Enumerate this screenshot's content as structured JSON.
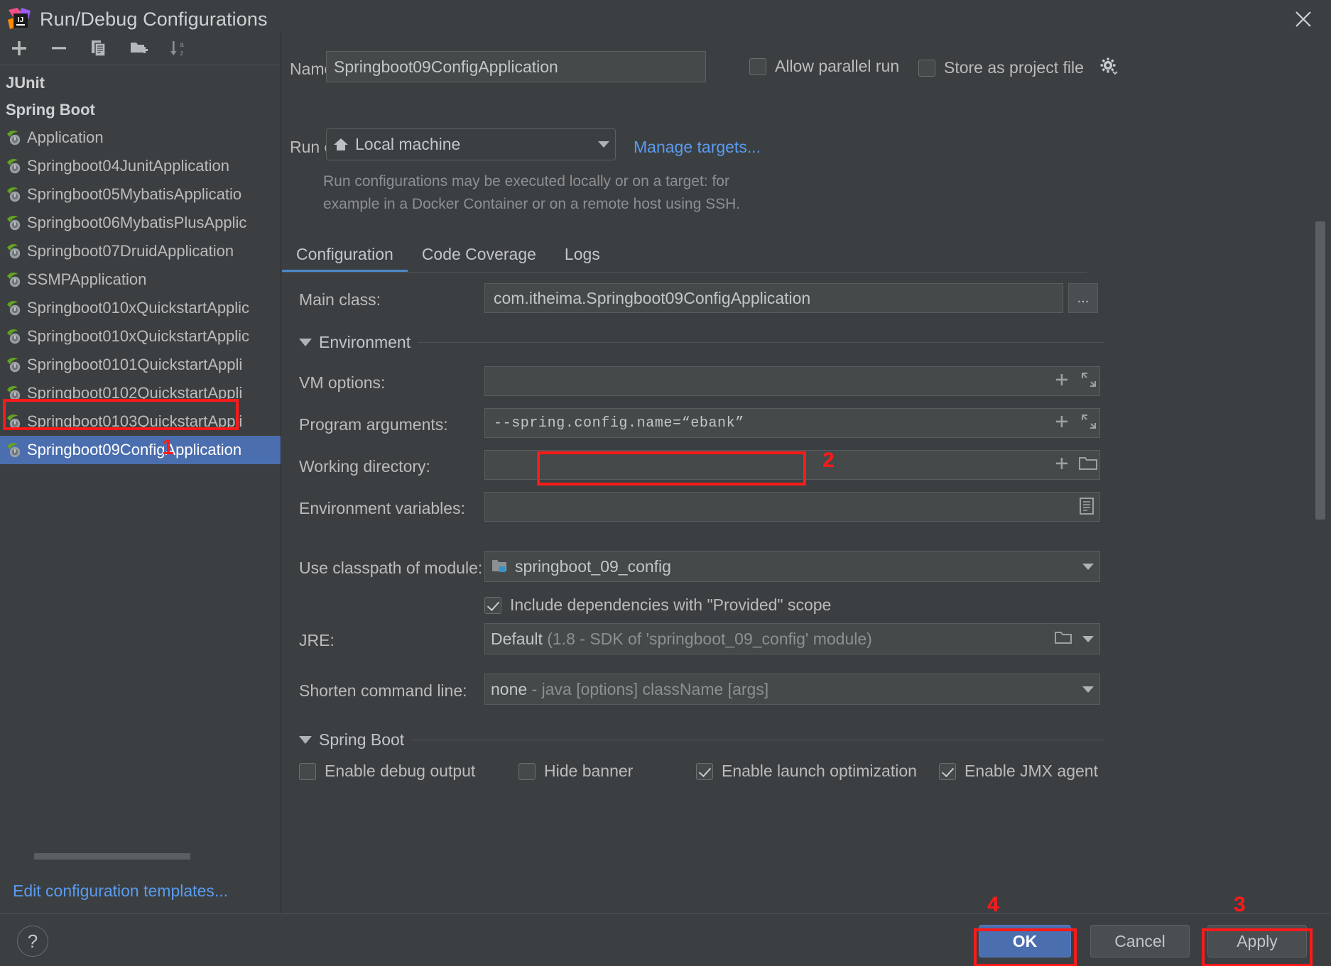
{
  "window": {
    "title": "Run/Debug Configurations",
    "logo_icon": "intellij-idea-logo",
    "close_icon": "close-icon"
  },
  "toolbar": {
    "buttons": [
      {
        "name": "add-configuration-button",
        "icon": "plus-icon",
        "label": "+"
      },
      {
        "name": "remove-configuration-button",
        "icon": "minus-icon",
        "label": "−"
      },
      {
        "name": "copy-configuration-button",
        "icon": "copy-icon",
        "label": "copy"
      },
      {
        "name": "save-configuration-button",
        "icon": "folder-add-icon",
        "label": "save"
      },
      {
        "name": "sort-configurations-button",
        "icon": "sort-alphabetically-icon",
        "label": "az"
      }
    ]
  },
  "sidebar": {
    "groups": [
      {
        "label": "JUnit",
        "items": []
      },
      {
        "label": "Spring Boot",
        "items": [
          {
            "label": "Application",
            "selected": false
          },
          {
            "label": "Springboot04JunitApplication",
            "selected": false
          },
          {
            "label": "Springboot05MybatisApplicatio",
            "selected": false
          },
          {
            "label": "Springboot06MybatisPlusApplic",
            "selected": false
          },
          {
            "label": "Springboot07DruidApplication",
            "selected": false
          },
          {
            "label": "SSMPApplication",
            "selected": false
          },
          {
            "label": "Springboot010xQuickstartApplic",
            "selected": false
          },
          {
            "label": "Springboot010xQuickstartApplic",
            "selected": false
          },
          {
            "label": "Springboot0101QuickstartAppli",
            "selected": false
          },
          {
            "label": "Springboot0102QuickstartAppli",
            "selected": false
          },
          {
            "label": "Springboot0103QuickstartAppli",
            "selected": false
          },
          {
            "label": "Springboot09ConfigApplication",
            "selected": true
          }
        ]
      }
    ],
    "edit_templates_link": "Edit configuration templates..."
  },
  "header": {
    "name_label": "Name:",
    "name_value": "Springboot09ConfigApplication",
    "allow_parallel_run_label": "Allow parallel run",
    "allow_parallel_run_checked": false,
    "store_as_project_file_label": "Store as project file",
    "store_as_project_file_checked": false,
    "run_on_label": "Run on:",
    "run_on_value": "Local machine",
    "run_on_icon": "home-icon",
    "manage_targets_link": "Manage targets...",
    "hint_line_1": "Run configurations may be executed locally or on a target: for",
    "hint_line_2": "example in a Docker Container or on a remote host using SSH."
  },
  "tabs": [
    {
      "label": "Configuration",
      "active": true
    },
    {
      "label": "Code Coverage",
      "active": false
    },
    {
      "label": "Logs",
      "active": false
    }
  ],
  "configuration": {
    "main_class_label": "Main class:",
    "main_class_value": "com.itheima.Springboot09ConfigApplication",
    "main_class_browse_label": "...",
    "environment_section_label": "Environment",
    "vm_options_label": "VM options:",
    "vm_options_value": "",
    "program_arguments_label": "Program arguments:",
    "program_arguments_value": "--spring.config.name=“ebank”",
    "working_directory_label": "Working directory:",
    "working_directory_value": "",
    "environment_variables_label": "Environment variables:",
    "environment_variables_value": "",
    "use_classpath_label": "Use classpath of module:",
    "use_classpath_value": "springboot_09_config",
    "module_icon": "module-folder-icon",
    "include_provided_label": "Include dependencies with \"Provided\" scope",
    "include_provided_checked": true,
    "jre_label": "JRE:",
    "jre_value": "Default",
    "jre_value_detail": "(1.8 - SDK of 'springboot_09_config' module)",
    "shorten_cmd_label": "Shorten command line:",
    "shorten_cmd_value": "none",
    "shorten_cmd_detail": "- java [options] className [args]",
    "spring_boot_section_label": "Spring Boot",
    "spring_boot_checkboxes": [
      {
        "label": "Enable debug output",
        "checked": false
      },
      {
        "label": "Hide banner",
        "checked": false
      },
      {
        "label": "Enable launch optimization",
        "checked": true
      },
      {
        "label": "Enable JMX agent",
        "checked": true
      }
    ]
  },
  "footer": {
    "help_label": "?",
    "ok_label": "OK",
    "cancel_label": "Cancel",
    "apply_label": "Apply"
  },
  "annotations": {
    "marker_1": "1",
    "marker_2": "2",
    "marker_3": "3",
    "marker_4": "4",
    "color": "#ff1a1a"
  }
}
